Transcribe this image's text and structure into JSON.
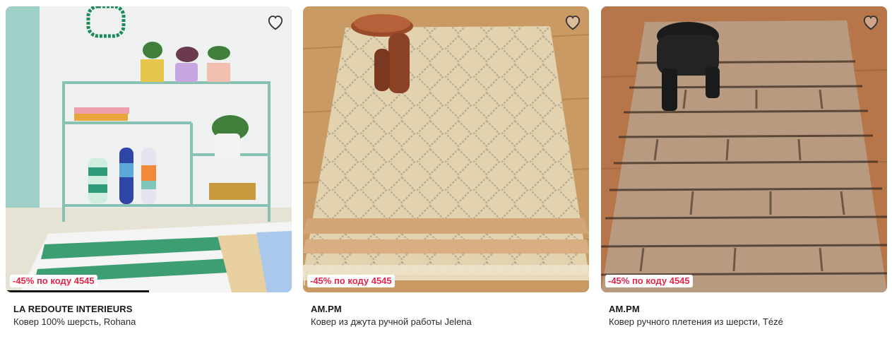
{
  "products": [
    {
      "brand": "LA REDOUTE INTERIEURS",
      "title": "Ковер 100% шерсть, Rohana",
      "promo": "-45% по коду 4545",
      "image_description": "striped green, white and beige wool rug with teal metal shelf"
    },
    {
      "brand": "AM.PM",
      "title": "Ковер из джута ручной работы Jelena",
      "promo": "-45% по коду 4545",
      "image_description": "beige jute rug with geometric pattern and wooden side table"
    },
    {
      "brand": "AM.PM",
      "title": "Ковер ручного плетения из шерсти, Tézé",
      "promo": "-45% по коду 4545",
      "image_description": "taupe textured wool rug with block pattern and black stool"
    }
  ],
  "icons": {
    "favorite": "heart-outline-icon"
  },
  "colors": {
    "promo_text": "#e0264b",
    "promo_bg": "#ffffff",
    "brand_text": "#1a1a1a"
  }
}
